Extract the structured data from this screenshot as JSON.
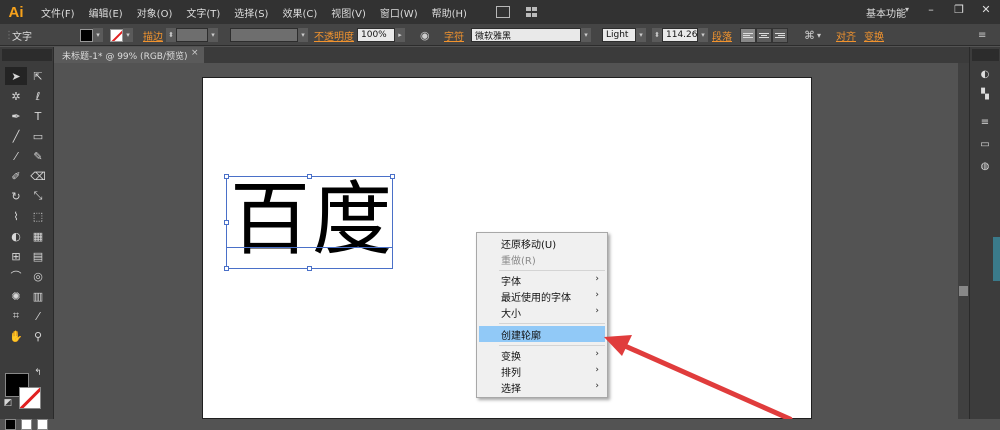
{
  "app": {
    "logo": "Ai"
  },
  "menu": [
    "文件(F)",
    "编辑(E)",
    "对象(O)",
    "文字(T)",
    "选择(S)",
    "效果(C)",
    "视图(V)",
    "窗口(W)",
    "帮助(H)"
  ],
  "workspace": {
    "label": "基本功能",
    "arrow": "▾"
  },
  "window_controls": [
    "–",
    "❐",
    "✕"
  ],
  "control_bar": {
    "object_type": "文字",
    "stroke_label": "描边",
    "opacity_label": "不透明度",
    "opacity_value": "100%",
    "char_label": "字符",
    "font_family": "微软雅黑",
    "font_style": "Light",
    "font_size": "114.26",
    "paragraph_label": "段落",
    "align_label": "对齐",
    "transform_label": "变换"
  },
  "document_tab": {
    "title": "未标题-1* @ 99% (RGB/预览)",
    "close": "×"
  },
  "artboard": {
    "text": "百度"
  },
  "context_menu": {
    "items": [
      {
        "label": "还原移动(U)",
        "enabled": true,
        "submenu": false
      },
      {
        "label": "重做(R)",
        "enabled": false,
        "submenu": false
      },
      {
        "label": "字体",
        "enabled": true,
        "submenu": true
      },
      {
        "label": "最近使用的字体",
        "enabled": true,
        "submenu": true
      },
      {
        "label": "大小",
        "enabled": true,
        "submenu": true
      },
      {
        "label": "创建轮廓",
        "enabled": true,
        "submenu": false,
        "highlighted": true
      },
      {
        "label": "变换",
        "enabled": true,
        "submenu": true
      },
      {
        "label": "排列",
        "enabled": true,
        "submenu": true
      },
      {
        "label": "选择",
        "enabled": true,
        "submenu": true
      }
    ],
    "submenu_arrow": "›"
  },
  "colors": {
    "accent_orange": "#f1932e",
    "annotation_arrow": "#e03c3c",
    "selection_blue": "#4a70c8",
    "menu_highlight": "#91c9f7"
  }
}
